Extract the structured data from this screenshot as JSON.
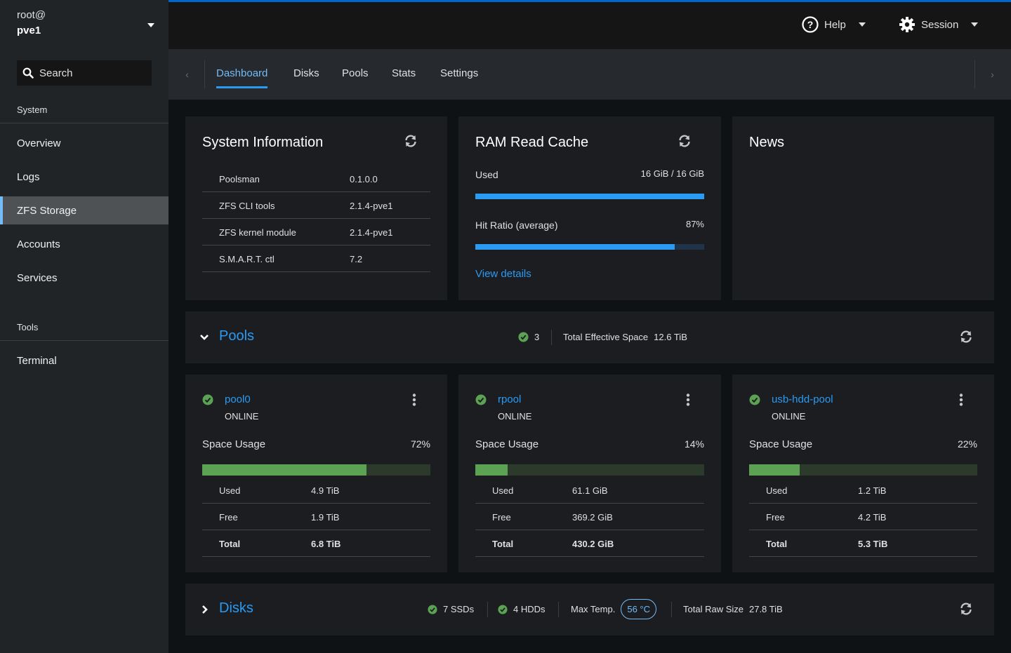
{
  "host": {
    "user": "root@",
    "name": "pve1"
  },
  "sidebar": {
    "search_label": "Search",
    "sections": [
      {
        "label": "System",
        "items": [
          "Overview",
          "Logs",
          "ZFS Storage",
          "Accounts",
          "Services"
        ]
      },
      {
        "label": "Tools",
        "items": [
          "Terminal"
        ]
      }
    ],
    "active_item": "ZFS Storage"
  },
  "topbar": {
    "help_label": "Help",
    "session_label": "Session"
  },
  "tabs": [
    {
      "label": "Dashboard",
      "active": true
    },
    {
      "label": "Disks",
      "active": false
    },
    {
      "label": "Pools",
      "active": false
    },
    {
      "label": "Stats",
      "active": false
    },
    {
      "label": "Settings",
      "active": false
    }
  ],
  "system_info": {
    "title": "System Information",
    "rows": [
      {
        "key": "Poolsman",
        "value": "0.1.0.0"
      },
      {
        "key": "ZFS CLI tools",
        "value": "2.1.4-pve1"
      },
      {
        "key": "ZFS kernel module",
        "value": "2.1.4-pve1"
      },
      {
        "key": "S.M.A.R.T. ctl",
        "value": "7.2"
      }
    ]
  },
  "ram_cache": {
    "title": "RAM Read Cache",
    "used_label": "Used",
    "used_value": "16 GiB / 16 GiB",
    "used_fraction": 1.0,
    "hit_label": "Hit Ratio (average)",
    "hit_value": "87%",
    "hit_fraction": 0.87,
    "details_link": "View details"
  },
  "news": {
    "title": "News"
  },
  "pools_section": {
    "title": "Pools",
    "online_count": "3",
    "effective_space_label": "Total Effective Space",
    "effective_space_value": "12.6 TiB"
  },
  "pools": [
    {
      "name": "pool0",
      "state": "ONLINE",
      "usage_label": "Space Usage",
      "usage_pct": "72%",
      "usage_fraction": 0.72,
      "rows": [
        {
          "key": "Used",
          "value": "4.9 TiB"
        },
        {
          "key": "Free",
          "value": "1.9 TiB"
        },
        {
          "key": "Total",
          "value": "6.8 TiB"
        }
      ]
    },
    {
      "name": "rpool",
      "state": "ONLINE",
      "usage_label": "Space Usage",
      "usage_pct": "14%",
      "usage_fraction": 0.14,
      "rows": [
        {
          "key": "Used",
          "value": "61.1 GiB"
        },
        {
          "key": "Free",
          "value": "369.2 GiB"
        },
        {
          "key": "Total",
          "value": "430.2 GiB"
        }
      ]
    },
    {
      "name": "usb-hdd-pool",
      "state": "ONLINE",
      "usage_label": "Space Usage",
      "usage_pct": "22%",
      "usage_fraction": 0.22,
      "rows": [
        {
          "key": "Used",
          "value": "1.2 TiB"
        },
        {
          "key": "Free",
          "value": "4.2 TiB"
        },
        {
          "key": "Total",
          "value": "5.3 TiB"
        }
      ]
    }
  ],
  "disks_section": {
    "title": "Disks",
    "ssd_label": "7 SSDs",
    "hdd_label": "4 HDDs",
    "max_temp_label": "Max Temp.",
    "max_temp_value": "56 °C",
    "raw_size_label": "Total Raw Size",
    "raw_size_value": "27.8 TiB"
  },
  "colors": {
    "accent": "#2b9af3",
    "ok": "#5ba352",
    "bg": "#0f1214",
    "card": "#1b1d21"
  }
}
